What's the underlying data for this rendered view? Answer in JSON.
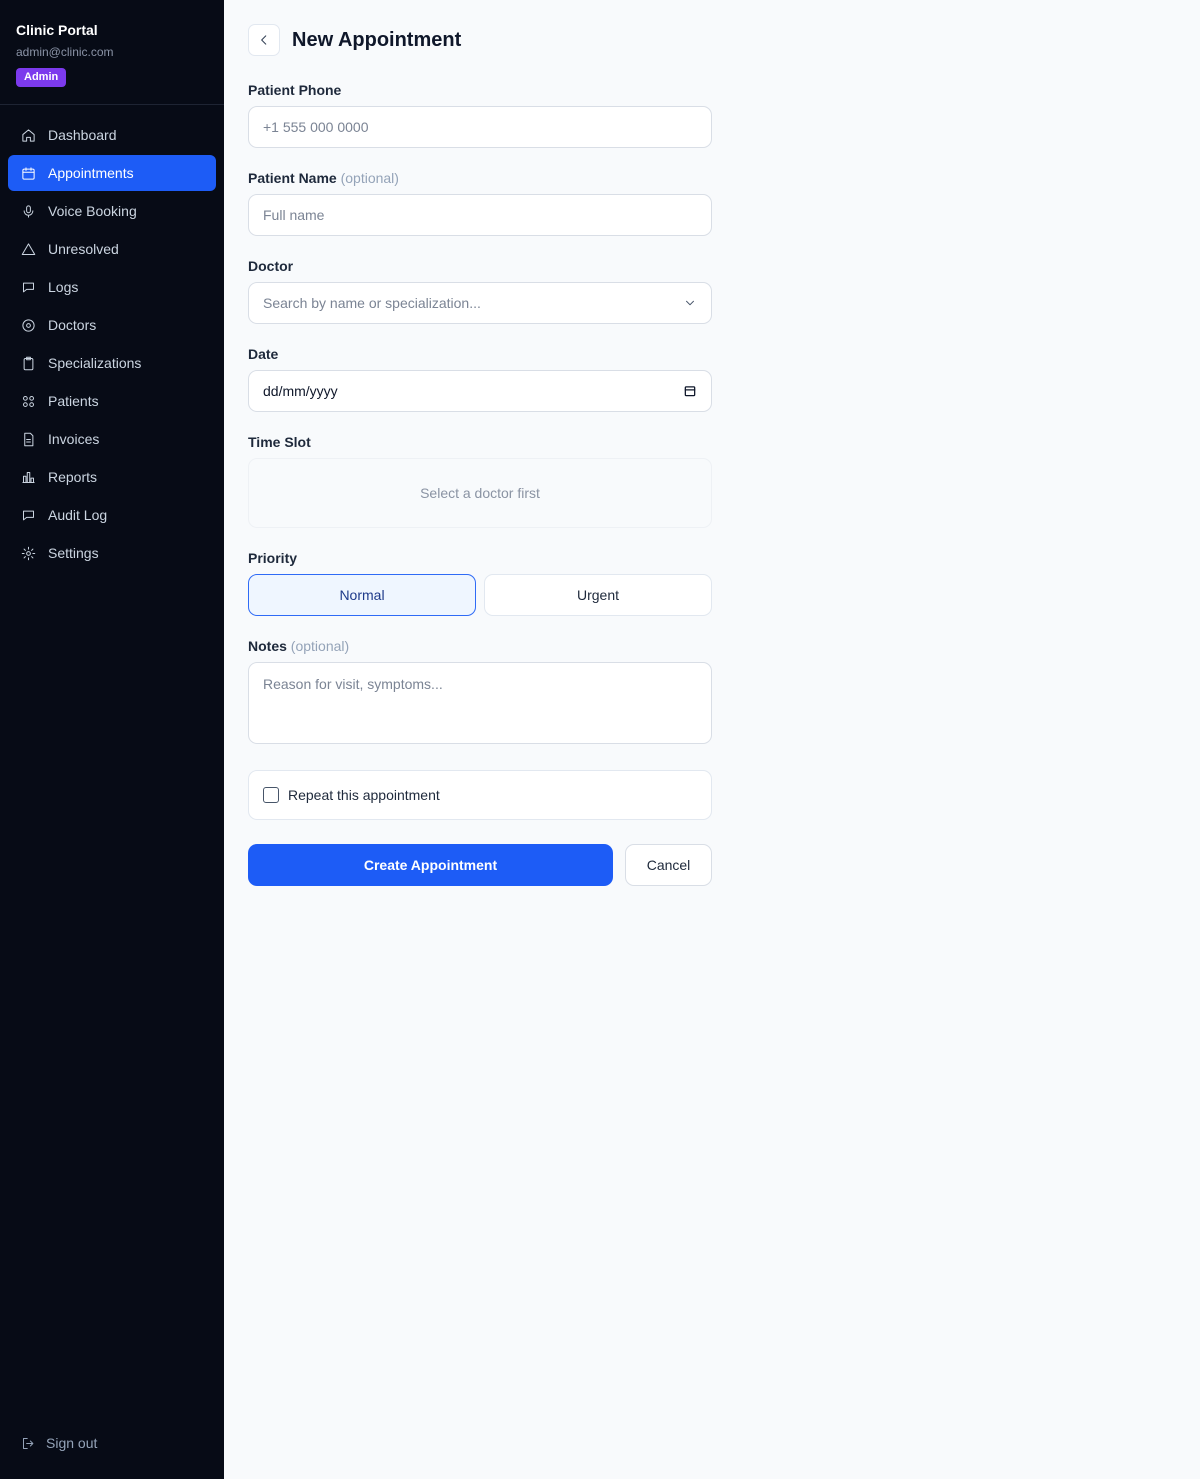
{
  "brand": {
    "title": "Clinic Portal",
    "email": "admin@clinic.com",
    "role_badge": "Admin"
  },
  "sidebar": {
    "items": [
      {
        "label": "Dashboard",
        "icon": "home-icon",
        "active": false
      },
      {
        "label": "Appointments",
        "icon": "calendar-icon",
        "active": true
      },
      {
        "label": "Voice Booking",
        "icon": "microphone-icon",
        "active": false
      },
      {
        "label": "Unresolved",
        "icon": "warning-triangle-icon",
        "active": false
      },
      {
        "label": "Logs",
        "icon": "message-icon",
        "active": false
      },
      {
        "label": "Doctors",
        "icon": "stethoscope-icon",
        "active": false
      },
      {
        "label": "Specializations",
        "icon": "clipboard-icon",
        "active": false
      },
      {
        "label": "Patients",
        "icon": "users-icon",
        "active": false
      },
      {
        "label": "Invoices",
        "icon": "file-text-icon",
        "active": false
      },
      {
        "label": "Reports",
        "icon": "bar-chart-icon",
        "active": false
      },
      {
        "label": "Audit Log",
        "icon": "message-icon",
        "active": false
      },
      {
        "label": "Settings",
        "icon": "gear-icon",
        "active": false
      }
    ],
    "signout_label": "Sign out"
  },
  "page": {
    "title": "New Appointment"
  },
  "form": {
    "phone": {
      "label": "Patient Phone",
      "placeholder": "+1 555 000 0000"
    },
    "name": {
      "label": "Patient Name",
      "optional": "(optional)",
      "placeholder": "Full name"
    },
    "doctor": {
      "label": "Doctor",
      "placeholder": "Search by name or specialization..."
    },
    "date": {
      "label": "Date",
      "value": "dd/mm/yyyy"
    },
    "time_slot": {
      "label": "Time Slot",
      "empty_text": "Select a doctor first"
    },
    "priority": {
      "label": "Priority",
      "options": [
        "Normal",
        "Urgent"
      ],
      "selected": "Normal"
    },
    "notes": {
      "label": "Notes",
      "optional": "(optional)",
      "placeholder": "Reason for visit, symptoms..."
    },
    "repeat": {
      "label": "Repeat this appointment",
      "checked": false
    },
    "submit_label": "Create Appointment",
    "cancel_label": "Cancel"
  },
  "colors": {
    "sidebar_bg": "#070b16",
    "accent": "#1d5cf6",
    "badge": "#7c3aed",
    "page_bg": "#f8fafc"
  }
}
